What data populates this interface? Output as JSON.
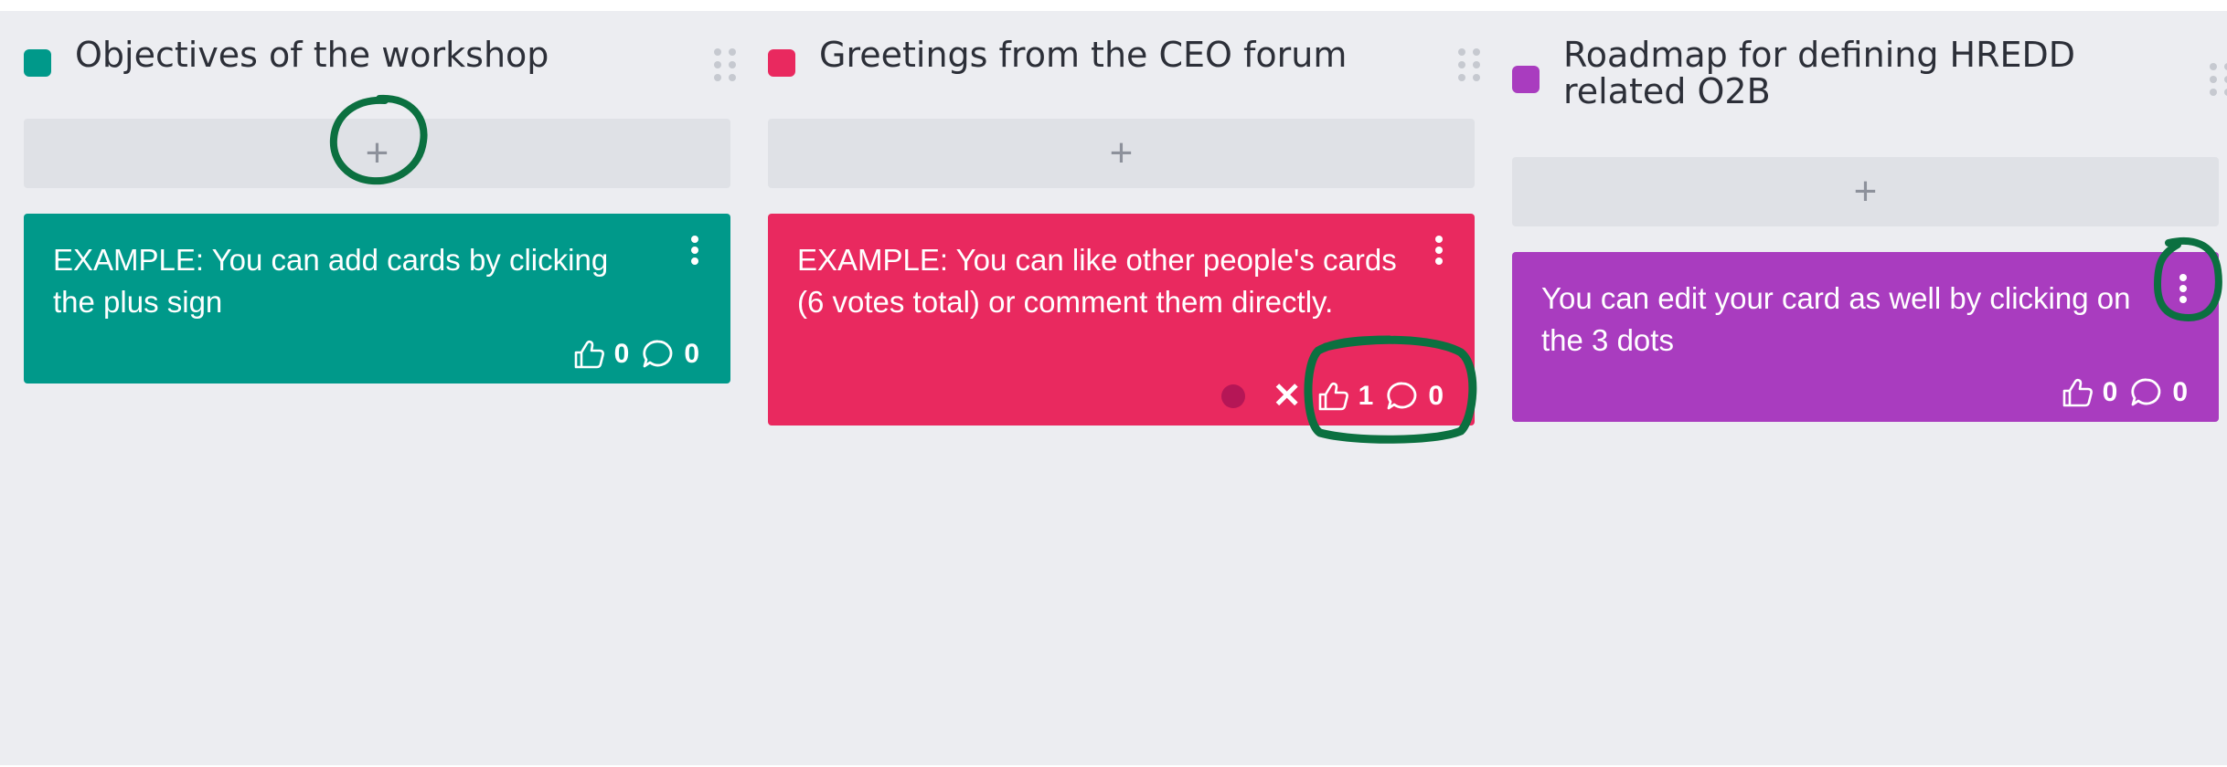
{
  "colors": {
    "teal": "#00998a",
    "pink": "#e9295f",
    "purple": "#a93cbf",
    "annotation": "#0b7040"
  },
  "columns": [
    {
      "title": "Objectives of the workshop",
      "add_label": "+",
      "card": {
        "text": "EXAMPLE: You can add cards by clicking the plus sign",
        "likes": "0",
        "comments": "0"
      }
    },
    {
      "title": "Greetings from the CEO forum",
      "add_label": "+",
      "card": {
        "text": "EXAMPLE: You can like other people's cards (6 votes total) or comment them directly.",
        "remove_vote_label": "✕",
        "likes": "1",
        "comments": "0"
      }
    },
    {
      "title": "Roadmap for defining HREDD related O2B",
      "add_label": "+",
      "card": {
        "text": "You can edit your card as well by clicking on the 3 dots",
        "likes": "0",
        "comments": "0"
      }
    }
  ]
}
